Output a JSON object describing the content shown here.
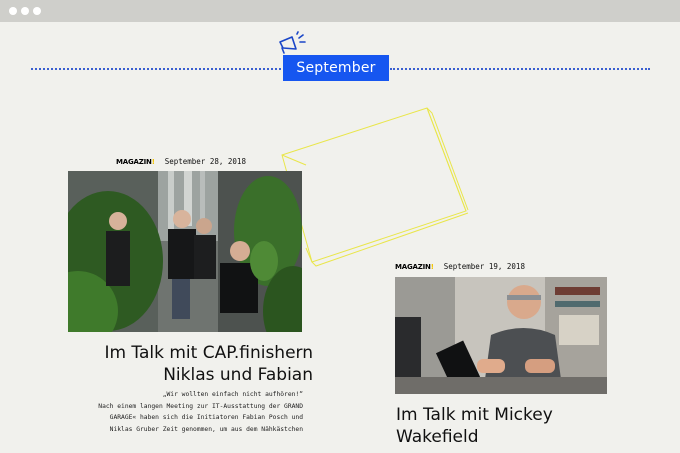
{
  "browser": {
    "dots": 3
  },
  "timeline": {
    "month_label": "September",
    "megaphone_icon": "megaphone-icon"
  },
  "posts": [
    {
      "category_logo": "MAGAZIN",
      "date": "September 28, 2018",
      "title_line1": "Im Talk mit CAP.finishern",
      "title_line2": "Niklas und Fabian",
      "excerpt": [
        "„Wir wollten einfach nicht aufhören!“",
        "Nach einem langen Meeting zur IT-Ausstattung der GRAND",
        "GARAGE« haben sich die Initiatoren Fabian Posch und",
        "Niklas Gruber Zeit genommen, um aus dem Nähkästchen"
      ]
    },
    {
      "category_logo": "MAGAZIN",
      "date": "September 19, 2018",
      "title_line1": "Im Talk mit Mickey",
      "title_line2": "Wakefield"
    }
  ],
  "colors": {
    "accent_blue": "#1656f0",
    "logo_yellow": "#f2c400",
    "deco_yellow": "#e9e64a",
    "background": "#f1f1ed"
  }
}
